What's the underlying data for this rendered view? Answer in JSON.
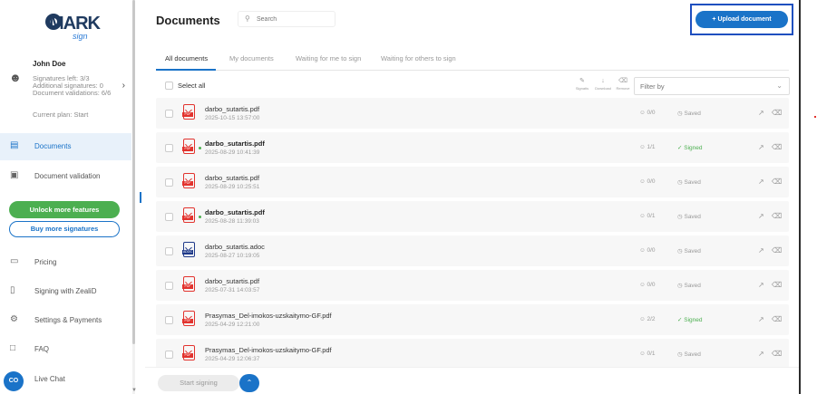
{
  "brand": {
    "logo_text": "MARK",
    "logo_sub": "sign"
  },
  "user": {
    "name": "John Doe",
    "signatures_left": "Signatures left: 3/3",
    "additional_signatures": "Additional signatures: 0",
    "document_validations": "Document validations: 6/6",
    "plan": "Current plan: Start"
  },
  "nav": {
    "documents": "Documents",
    "document_validation": "Document validation",
    "pricing": "Pricing",
    "signing_zealid": "Signing with ZealiD",
    "settings": "Settings & Payments",
    "faq": "FAQ",
    "live_chat": "Live Chat"
  },
  "buttons": {
    "unlock": "Unlock more features",
    "buy": "Buy more signatures",
    "upload": "+ Upload document",
    "start_signing": "Start signing",
    "chat_badge": "CO"
  },
  "header": {
    "title": "Documents",
    "search_placeholder": "Search"
  },
  "tabs": [
    "All documents",
    "My documents",
    "Waiting for me to sign",
    "Waiting for others to sign"
  ],
  "toolbar": {
    "select_all": "Select all",
    "signatis": "Signatis",
    "download": "Download",
    "remove": "Remove",
    "filter": "Filter by"
  },
  "documents": [
    {
      "name": "darbo_sutartis.pdf",
      "date": "2025-10-15 13:57:00",
      "count": "0/0",
      "status": "Saved",
      "type": "pdf",
      "unread": false
    },
    {
      "name": "darbo_sutartis.pdf",
      "date": "2025-08-29 10:41:39",
      "count": "1/1",
      "status": "Signed",
      "type": "pdf",
      "unread": true
    },
    {
      "name": "darbo_sutartis.pdf",
      "date": "2025-08-29 10:25:51",
      "count": "0/0",
      "status": "Saved",
      "type": "pdf",
      "unread": false
    },
    {
      "name": "darbo_sutartis.pdf",
      "date": "2025-08-28 11:39:03",
      "count": "0/1",
      "status": "Saved",
      "type": "pdf",
      "unread": true
    },
    {
      "name": "darbo_sutartis.adoc",
      "date": "2025-08-27 10:19:05",
      "count": "0/0",
      "status": "Saved",
      "type": "adoc",
      "unread": false
    },
    {
      "name": "darbo_sutartis.pdf",
      "date": "2025-07-31 14:03:57",
      "count": "0/0",
      "status": "Saved",
      "type": "pdf",
      "unread": false
    },
    {
      "name": "Prasymas_Del-imokos-uzskaitymo-GF.pdf",
      "date": "2025-04-29 12:21:00",
      "count": "2/2",
      "status": "Signed",
      "type": "pdf",
      "unread": false
    },
    {
      "name": "Prasymas_Del-imokos-uzskaitymo-GF.pdf",
      "date": "2025-04-29 12:06:37",
      "count": "0/1",
      "status": "Saved",
      "type": "pdf",
      "unread": false
    }
  ],
  "colors": {
    "accent": "#1a73c8",
    "green": "#4caf50",
    "pdf_red": "#e2332e",
    "adoc_blue": "#1f3a8a"
  }
}
